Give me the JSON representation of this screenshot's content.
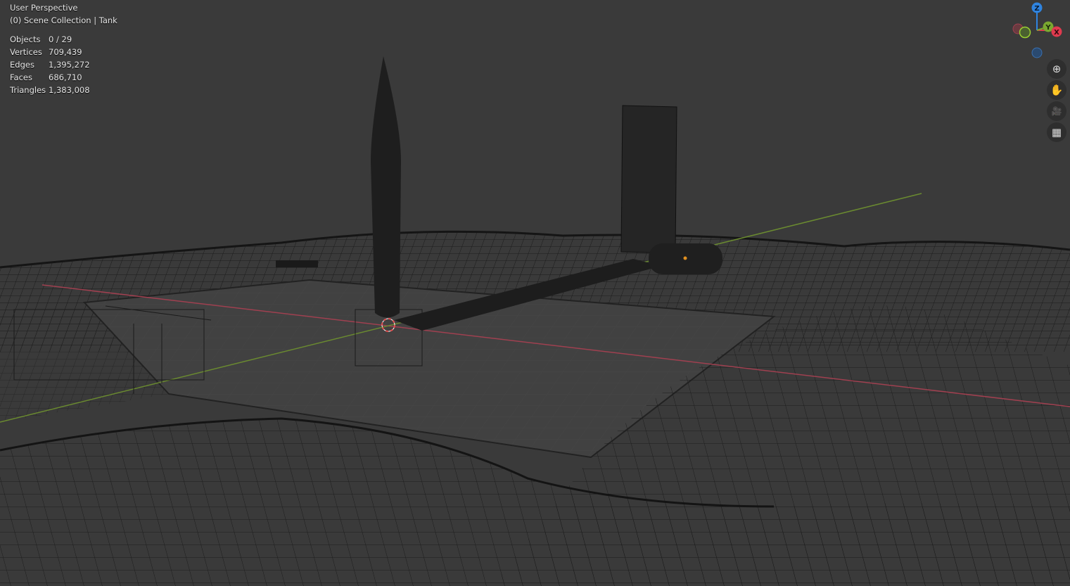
{
  "viewport": {
    "view_name": "User Perspective",
    "collection": "(0) Scene Collection | Tank"
  },
  "stats": [
    {
      "label": "Objects",
      "value": "0 / 29"
    },
    {
      "label": "Vertices",
      "value": "709,439"
    },
    {
      "label": "Edges",
      "value": "1,395,272"
    },
    {
      "label": "Faces",
      "value": "686,710"
    },
    {
      "label": "Triangles",
      "value": "1,383,008"
    }
  ],
  "gizmo": {
    "z_label": "Z",
    "y_label": "Y",
    "x_label": "X",
    "colors": {
      "x": "#e03a4e",
      "y": "#7aa830",
      "z": "#2f84e0"
    }
  },
  "nav_buttons": [
    {
      "name": "zoom-button",
      "icon": "magnifier-plus-icon",
      "glyph": "⊕"
    },
    {
      "name": "pan-button",
      "icon": "hand-icon",
      "glyph": "✋"
    },
    {
      "name": "camera-view-button",
      "icon": "camera-icon",
      "glyph": "🎥"
    },
    {
      "name": "ortho-toggle-button",
      "icon": "grid-icon",
      "glyph": "▦"
    }
  ]
}
